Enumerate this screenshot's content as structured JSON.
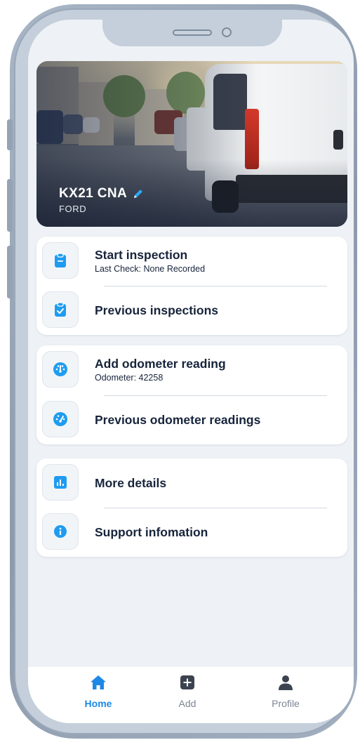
{
  "vehicle": {
    "registration": "KX21 CNA",
    "make": "FORD"
  },
  "inspections": {
    "start": {
      "title": "Start inspection",
      "subtitle": "Last Check: None Recorded",
      "icon": "clipboard-icon"
    },
    "previous": {
      "title": "Previous inspections",
      "icon": "clipboard-check-icon"
    }
  },
  "odometer": {
    "add": {
      "title": "Add odometer reading",
      "subtitle": "Odometer: 42258",
      "icon": "gauge-icon"
    },
    "previous": {
      "title": "Previous odometer readings",
      "icon": "gauge-history-icon"
    }
  },
  "info": {
    "details": {
      "title": "More details",
      "icon": "bar-chart-icon"
    },
    "support": {
      "title": "Support infomation",
      "icon": "info-icon"
    }
  },
  "nav": {
    "home": {
      "label": "Home",
      "icon": "home-icon",
      "active": true
    },
    "add": {
      "label": "Add",
      "icon": "plus-square-icon",
      "active": false
    },
    "profile": {
      "label": "Profile",
      "icon": "person-icon",
      "active": false
    }
  },
  "colors": {
    "accent": "#1e9cf0",
    "nav_active": "#1e88e5",
    "title_text": "#17243b",
    "screen_bg": "#eef2f6"
  }
}
